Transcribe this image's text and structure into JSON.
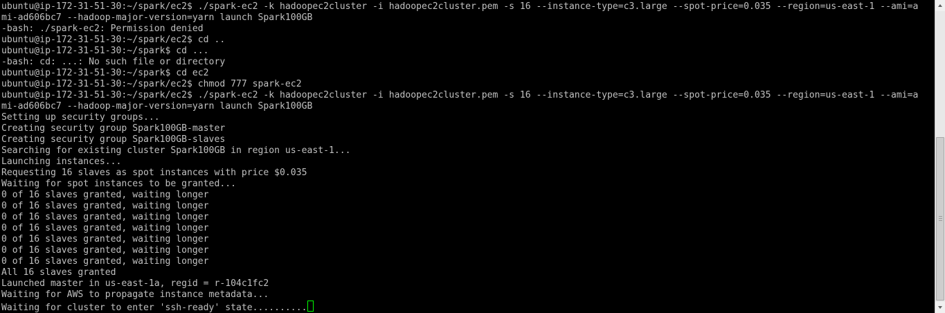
{
  "terminal": {
    "lines": [
      "ubuntu@ip-172-31-51-30:~/spark/ec2$ ./spark-ec2 -k hadoopec2cluster -i hadoopec2cluster.pem -s 16 --instance-type=c3.large --spot-price=0.035 --region=us-east-1 --ami=a",
      "mi-ad606bc7 --hadoop-major-version=yarn launch Spark100GB",
      "-bash: ./spark-ec2: Permission denied",
      "ubuntu@ip-172-31-51-30:~/spark/ec2$ cd ..",
      "ubuntu@ip-172-31-51-30:~/spark$ cd ...",
      "-bash: cd: ...: No such file or directory",
      "ubuntu@ip-172-31-51-30:~/spark$ cd ec2",
      "ubuntu@ip-172-31-51-30:~/spark/ec2$ chmod 777 spark-ec2",
      "ubuntu@ip-172-31-51-30:~/spark/ec2$ ./spark-ec2 -k hadoopec2cluster -i hadoopec2cluster.pem -s 16 --instance-type=c3.large --spot-price=0.035 --region=us-east-1 --ami=a",
      "mi-ad606bc7 --hadoop-major-version=yarn launch Spark100GB",
      "Setting up security groups...",
      "Creating security group Spark100GB-master",
      "Creating security group Spark100GB-slaves",
      "Searching for existing cluster Spark100GB in region us-east-1...",
      "Launching instances...",
      "Requesting 16 slaves as spot instances with price $0.035",
      "Waiting for spot instances to be granted...",
      "0 of 16 slaves granted, waiting longer",
      "0 of 16 slaves granted, waiting longer",
      "0 of 16 slaves granted, waiting longer",
      "0 of 16 slaves granted, waiting longer",
      "0 of 16 slaves granted, waiting longer",
      "0 of 16 slaves granted, waiting longer",
      "0 of 16 slaves granted, waiting longer",
      "All 16 slaves granted",
      "Launched master in us-east-1a, regid = r-104c1fc2",
      "Waiting for AWS to propagate instance metadata...",
      "Waiting for cluster to enter 'ssh-ready' state.........."
    ]
  },
  "colors": {
    "background": "#000000",
    "text": "#c0c0c0",
    "cursor": "#00ff00"
  },
  "icons": {
    "scroll_up": "arrow-up-icon",
    "scroll_down": "arrow-down-icon"
  }
}
